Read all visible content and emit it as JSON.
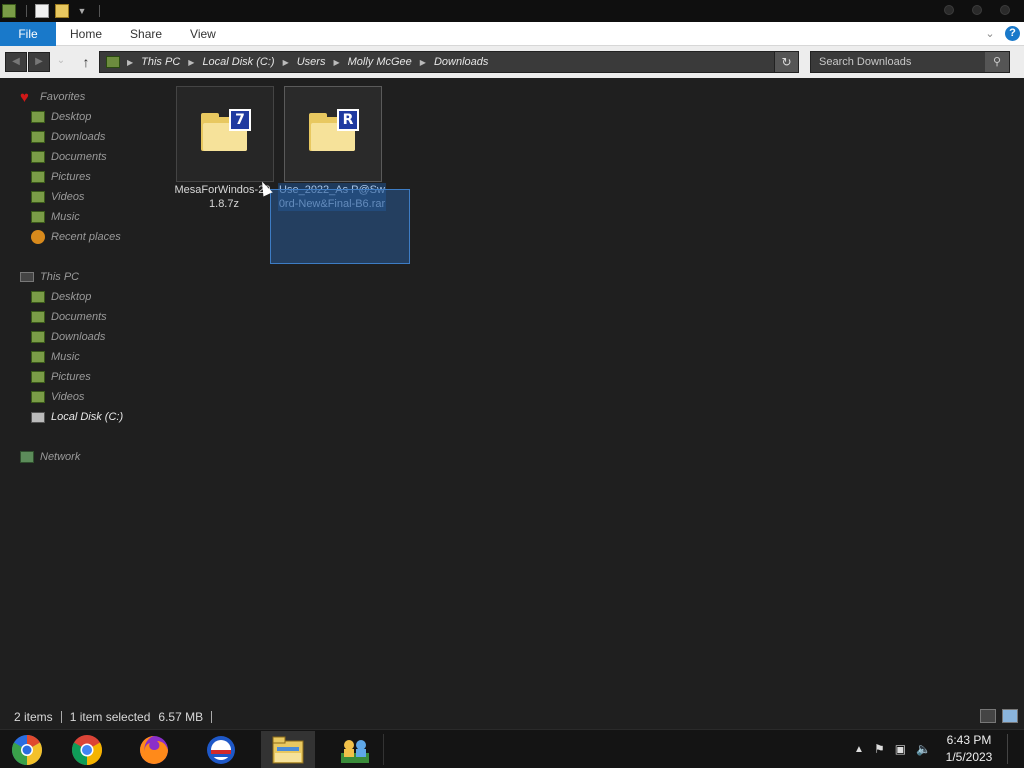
{
  "titlebar": {
    "icons": [
      "folder-green-icon",
      "properties-icon",
      "new-folder-icon",
      "customize-dropdown-icon"
    ]
  },
  "ribbon": {
    "tabs": {
      "file": "File",
      "home": "Home",
      "share": "Share",
      "view": "View"
    },
    "help_label": "?"
  },
  "address": {
    "crumbs": [
      "This PC",
      "Local Disk (C:)",
      "Users",
      "Molly McGee",
      "Downloads"
    ],
    "search_placeholder": "Search Downloads"
  },
  "sidebar": {
    "favorites_label": "Favorites",
    "favorites": [
      "Desktop",
      "Downloads",
      "Documents",
      "Pictures",
      "Videos",
      "Music",
      "Recent places"
    ],
    "this_pc_label": "This PC",
    "this_pc": [
      "Desktop",
      "Documents",
      "Downloads",
      "Music",
      "Pictures",
      "Videos",
      "Local Disk (C:)"
    ],
    "selected": "Local Disk (C:)",
    "network_label": "Network"
  },
  "files": [
    {
      "name": "MesaForWindows-20.1.8.7z",
      "name_display": "MesaForWindo​s-20.1.8.7z",
      "badge": "7",
      "selected": false
    },
    {
      "name": "Use_2022_As P@Sw0rd-New&Final-B6.rar",
      "name_display": "Use_2022_As P@Sw0rd-New&Final-B6.rar",
      "badge": "R",
      "selected": true
    }
  ],
  "status": {
    "item_count": "2 items",
    "selection": "1 item selected",
    "size": "6.57 MB"
  },
  "taskbar": {
    "apps": [
      "chromium-icon",
      "chrome-icon",
      "firefox-icon",
      "ie-icon",
      "file-explorer-icon",
      "network-people-icon"
    ],
    "active_app": "file-explorer-icon",
    "time": "6:43 PM",
    "date": "1/5/2023"
  },
  "colors": {
    "accent": "#1979ca",
    "background": "#1f1f1f",
    "selection": "#1e3a5c"
  }
}
